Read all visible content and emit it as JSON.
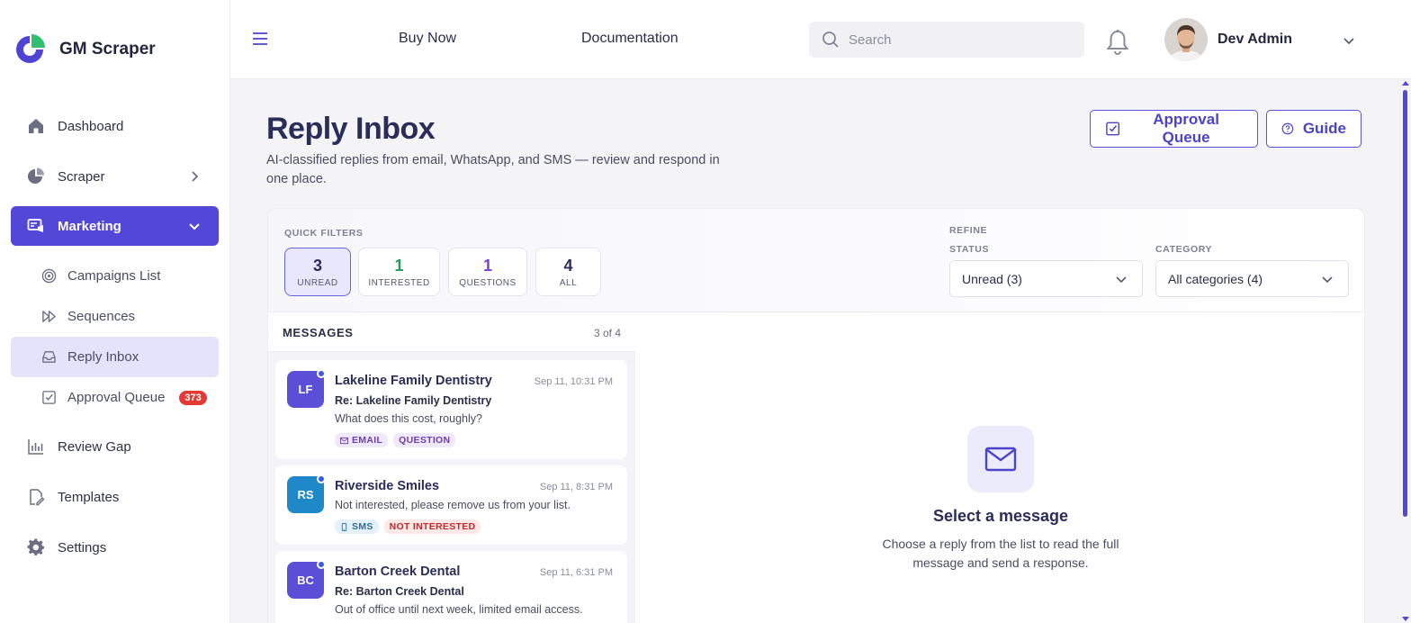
{
  "brand": {
    "name": "GM Scraper"
  },
  "colors": {
    "accent": "#5247d6",
    "badge": "#e53935",
    "interested": "#1f9d55",
    "questions": "#7b3fd6"
  },
  "sidebar": {
    "items": [
      {
        "label": "Dashboard",
        "icon": "home-icon"
      },
      {
        "label": "Scraper",
        "icon": "pie-chart-icon"
      },
      {
        "label": "Marketing",
        "icon": "marketing-icon"
      },
      {
        "label": "Review Gap",
        "icon": "bar-chart-icon"
      },
      {
        "label": "Templates",
        "icon": "document-edit-icon"
      },
      {
        "label": "Settings",
        "icon": "gear-icon"
      }
    ],
    "marketing_sub": [
      {
        "label": "Campaigns List",
        "icon": "target-icon"
      },
      {
        "label": "Sequences",
        "icon": "fast-forward-icon"
      },
      {
        "label": "Reply Inbox",
        "icon": "inbox-icon"
      },
      {
        "label": "Approval Queue",
        "icon": "checkbox-icon",
        "badge": "373"
      }
    ]
  },
  "topbar": {
    "links": [
      "Buy Now",
      "Documentation"
    ],
    "search_placeholder": "Search",
    "user_name": "Dev Admin"
  },
  "page": {
    "title": "Reply Inbox",
    "subtitle": "AI-classified replies from email, WhatsApp, and SMS — review and respond in one place.",
    "buttons": {
      "approval_queue": "Approval Queue",
      "guide": "Guide"
    }
  },
  "filters": {
    "quick_label": "QUICK FILTERS",
    "quick": [
      {
        "count": "3",
        "label": "UNREAD",
        "selected": true
      },
      {
        "count": "1",
        "label": "INTERESTED"
      },
      {
        "count": "1",
        "label": "QUESTIONS"
      },
      {
        "count": "4",
        "label": "ALL"
      }
    ],
    "refine_label": "REFINE",
    "status_label": "STATUS",
    "status_value": "Unread (3)",
    "category_label": "CATEGORY",
    "category_value": "All categories (4)"
  },
  "messages": {
    "header": "MESSAGES",
    "count": "3 of 4",
    "items": [
      {
        "initials": "LF",
        "name": "Lakeline Family Dentistry",
        "time": "Sep 11, 10:31 PM",
        "subject": "Re: Lakeline Family Dentistry",
        "preview": "What does this cost, roughly?",
        "channel": "EMAIL",
        "category": "QUESTION",
        "avatar_color": "#5b4fd8",
        "unread": true
      },
      {
        "initials": "RS",
        "name": "Riverside Smiles",
        "time": "Sep 11, 8:31 PM",
        "subject": "",
        "preview": "Not interested, please remove us from your list.",
        "channel": "SMS",
        "category": "NOT INTERESTED",
        "avatar_color": "#1e88c9",
        "unread": true
      },
      {
        "initials": "BC",
        "name": "Barton Creek Dental",
        "time": "Sep 11, 6:31 PM",
        "subject": "Re: Barton Creek Dental",
        "preview": "Out of office until next week, limited email access.",
        "channel": "",
        "category": "",
        "avatar_color": "#5b4fd8",
        "unread": true
      }
    ]
  },
  "detail": {
    "empty_title": "Select a message",
    "empty_text": "Choose a reply from the list to read the full message and send a response."
  }
}
